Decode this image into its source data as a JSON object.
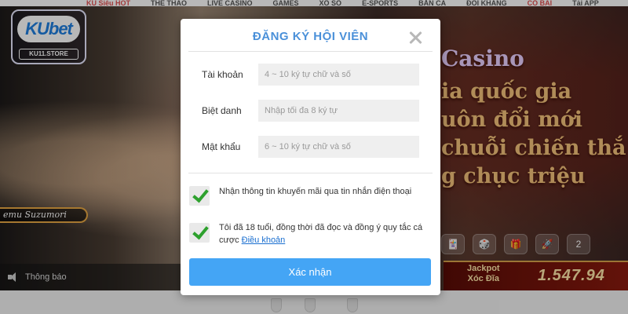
{
  "background": {
    "nav_items": [
      "KU Siêu HOT",
      "THỂ THAO",
      "LIVE CASINO",
      "GAMES",
      "XỔ SỐ",
      "E-SPORTS",
      "BẮN CÁ",
      "ĐỐI KHÁNG",
      "CỔ BÀI",
      "Tải APP"
    ],
    "logo_text": "KUbet",
    "logo_sub": "KU11.STORE",
    "model_name": "emu Suzumori",
    "notice_label": "Thông báo",
    "promo_title": "Casino",
    "promo_lines": [
      "ia quốc gia",
      "uôn đổi mới",
      "chuỗi chiến thắ",
      "g chục triệu"
    ],
    "game_icons": [
      "🃏",
      "🎲",
      "🎁",
      "🚀",
      "2"
    ],
    "jackpot_label_1": "Jackpot",
    "jackpot_label_2": "Xóc Đĩa",
    "jackpot_value": "1.547.94"
  },
  "modal": {
    "title": "ĐĂNG KÝ HỘI VIÊN",
    "fields": [
      {
        "label": "Tài khoản",
        "placeholder": "4 ~ 10 ký tự chữ và số",
        "value": ""
      },
      {
        "label": "Biệt danh",
        "placeholder": "Nhập tối đa 8 ký tự",
        "value": ""
      },
      {
        "label": "Mật khẩu",
        "placeholder": "6 ~ 10 ký tự chữ và số",
        "value": ""
      }
    ],
    "checks": [
      {
        "checked": true,
        "text": "Nhận thông tin khuyến mãi qua tin nhắn điện thoại"
      },
      {
        "checked": true,
        "text": "Tôi đã 18 tuổi, đồng thời đã đọc và đồng ý quy tắc cá cược ",
        "link": "Điều khoản"
      }
    ],
    "submit_label": "Xác nhận"
  },
  "colors": {
    "title_blue": "#4a90d9",
    "submit_blue": "#44a5f5",
    "check_green": "#2ea12e",
    "link_blue": "#1a6fd0"
  }
}
